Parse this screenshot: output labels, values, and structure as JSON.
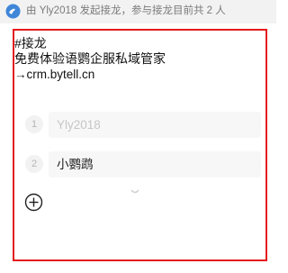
{
  "header": {
    "icon": "jielong-app-icon",
    "text": "由 Yly2018 发起接龙，参与接龙目前共 2 人"
  },
  "post": {
    "lines": [
      "#接龙",
      "免费体验语鹦企服私域管家",
      "→crm.bytell.cn"
    ]
  },
  "entries": [
    {
      "number": "1",
      "value": "Yly2018",
      "state": "muted"
    },
    {
      "number": "2",
      "value": "小鹦鹉",
      "state": "filled"
    }
  ],
  "add_button": {
    "icon": "add-circle-icon"
  },
  "colors": {
    "highlight_border": "#e31a1c",
    "header_bg": "#f2f2f2",
    "entry_bg": "#f7f7f7"
  }
}
